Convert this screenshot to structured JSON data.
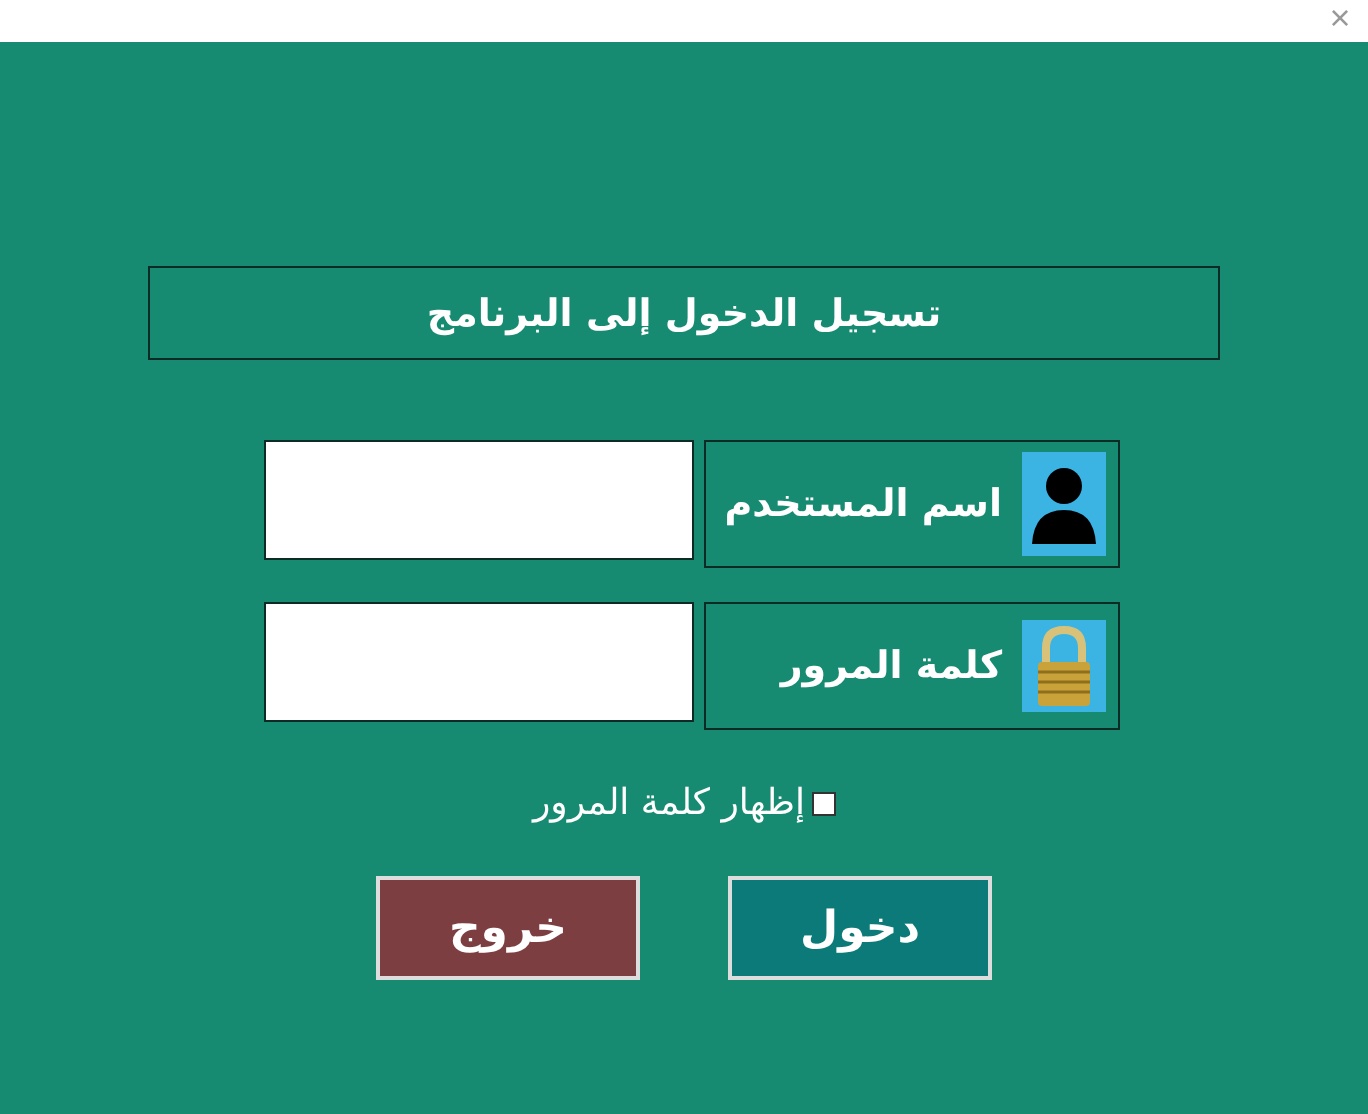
{
  "window": {
    "close": "×"
  },
  "title": "تسجيل الدخول إلى البرنامج",
  "fields": [
    {
      "kind": "user",
      "label": "اسم المستخدم"
    },
    {
      "kind": "password",
      "label": "كلمة المرور"
    }
  ],
  "show_password": {
    "label": "إظهار كلمة المرور",
    "checked": false
  },
  "buttons": [
    {
      "kind": "login",
      "label": "دخول"
    },
    {
      "kind": "exit",
      "label": "خروج"
    }
  ]
}
